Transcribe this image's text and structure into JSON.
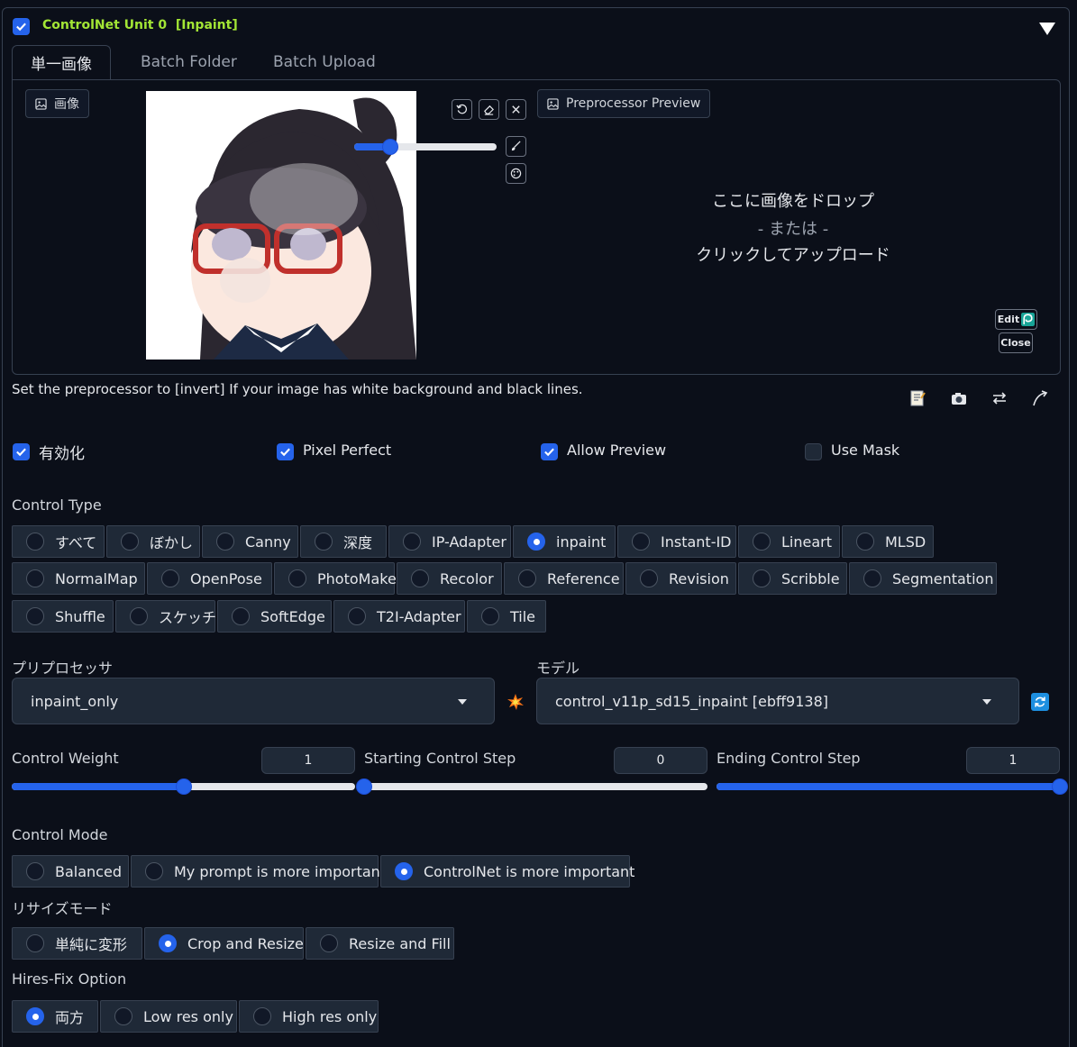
{
  "unit": {
    "title": "ControlNet Unit 0",
    "tag": "[Inpaint]",
    "enabled": true
  },
  "tabs": [
    {
      "label": "単一画像",
      "active": true
    },
    {
      "label": "Batch Folder",
      "active": false
    },
    {
      "label": "Batch Upload",
      "active": false
    }
  ],
  "image_panel": {
    "label": "画像",
    "brush_size": 0.45
  },
  "preview_panel": {
    "label": "Preprocessor Preview",
    "drop_line1": "ここに画像をドロップ",
    "drop_or": "- または -",
    "drop_line2": "クリックしてアップロード",
    "edit_label": "Edit",
    "close_label": "Close"
  },
  "hint": "Set the preprocessor to [invert] If your image has white background and black lines.",
  "options": [
    {
      "label": "有効化",
      "checked": true
    },
    {
      "label": "Pixel Perfect",
      "checked": true
    },
    {
      "label": "Allow Preview",
      "checked": true
    },
    {
      "label": "Use Mask",
      "checked": false
    }
  ],
  "control_type": {
    "label": "Control Type",
    "selected": "inpaint",
    "items": [
      "すべて",
      "ぼかし",
      "Canny",
      "深度",
      "IP-Adapter",
      "inpaint",
      "Instant-ID",
      "Lineart",
      "MLSD",
      "NormalMap",
      "OpenPose",
      "PhotoMaker",
      "Recolor",
      "Reference",
      "Revision",
      "Scribble",
      "Segmentation",
      "Shuffle",
      "スケッチ",
      "SoftEdge",
      "T2I-Adapter",
      "Tile"
    ]
  },
  "preprocessor": {
    "label": "プリプロセッサ",
    "value": "inpaint_only"
  },
  "model": {
    "label": "モデル",
    "value": "control_v11p_sd15_inpaint [ebff9138]"
  },
  "sliders": {
    "weight": {
      "label": "Control Weight",
      "value": "1",
      "fraction": 0.5
    },
    "start": {
      "label": "Starting Control Step",
      "value": "0",
      "fraction": 0
    },
    "end": {
      "label": "Ending Control Step",
      "value": "1",
      "fraction": 1
    }
  },
  "control_mode": {
    "label": "Control Mode",
    "items": [
      "Balanced",
      "My prompt is more important",
      "ControlNet is more important"
    ],
    "selected": "ControlNet is more important"
  },
  "resize_mode": {
    "label": "リサイズモード",
    "items": [
      "単純に変形",
      "Crop and Resize",
      "Resize and Fill"
    ],
    "selected": "Crop and Resize"
  },
  "hires_fix": {
    "label": "Hires-Fix Option",
    "items": [
      "両方",
      "Low res only",
      "High res only"
    ],
    "selected": "両方"
  },
  "colors": {
    "accent": "#2563eb",
    "title": "#a3e635",
    "bg": "#0b0f19",
    "panel": "#1f2937",
    "border": "#374151"
  }
}
